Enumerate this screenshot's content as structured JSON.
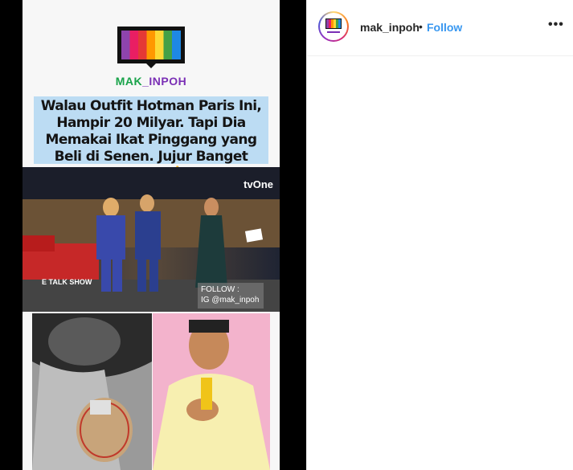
{
  "header": {
    "username": "mak_inpoh",
    "separator": "•",
    "follow_label": "Follow",
    "more_label": "•••"
  },
  "post": {
    "logo_text_left": "MAK",
    "logo_text_mid": "_",
    "logo_text_right": "INPOH",
    "caption": "Walau Outfit Hotman Paris Ini, Hampir 20 Milyar. Tapi Dia Memakai Ikat Pinggang yang Beli di Senen. Jujur Banget Abang",
    "caption_emoji": "👍",
    "channel_logo": "tvOne",
    "show_logo": "E TALK SHOW",
    "follow_overlay_line1": "FOLLOW :",
    "follow_overlay_line2": "IG @mak_inpoh"
  },
  "colors": {
    "follow_blue": "#3897f0",
    "caption_bg": "#bcdcf3",
    "logo_green": "#19a34a",
    "logo_purple": "#7a2fb5"
  }
}
